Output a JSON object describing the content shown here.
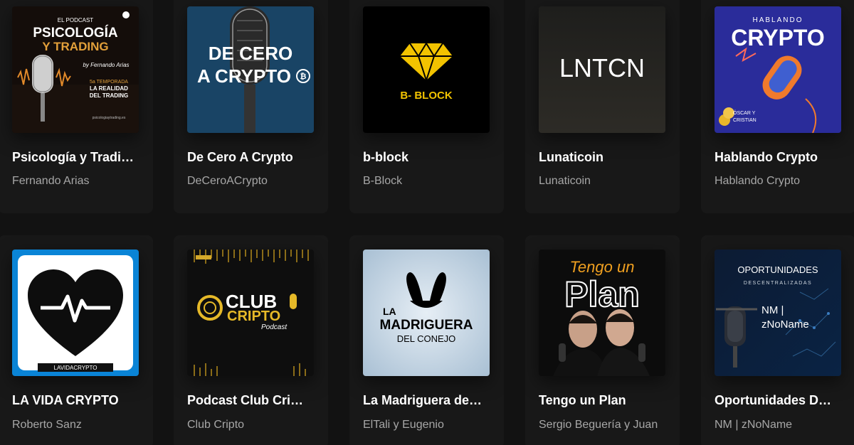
{
  "podcasts": [
    {
      "title": "Psicología y Tradi…",
      "author": "Fernando Arias",
      "cover": {
        "line1": "EL PODCAST",
        "line2": "PSICOLOGÍA",
        "line3": "Y TRADING",
        "line4": "by Fernando Arias",
        "line5": "5a TEMPORADA",
        "line6": "LA REALIDAD",
        "line7": "DEL TRADING",
        "line8": "psicologiaytrading.es"
      }
    },
    {
      "title": "De Cero A Crypto",
      "author": "DeCeroACrypto",
      "cover": {
        "line1": "DE CERO",
        "line2": "A CRYPTO"
      }
    },
    {
      "title": "b-block",
      "author": "B-Block",
      "cover": {
        "line1": "B- BLOCK"
      }
    },
    {
      "title": "Lunaticoin",
      "author": "Lunaticoin",
      "cover": {
        "line1": "LNTCN"
      }
    },
    {
      "title": "Hablando Crypto",
      "author": "Hablando Crypto",
      "cover": {
        "line1": "HABLANDO",
        "line2": "CRYPTO",
        "line3": "ÓSCAR Y",
        "line4": "CRISTIAN"
      }
    },
    {
      "title": "LA VIDA CRYPTO",
      "author": "Roberto Sanz",
      "cover": {
        "line1": "LAVIDACRYPTO"
      }
    },
    {
      "title": "Podcast Club Cri…",
      "author": "Club Cripto",
      "cover": {
        "line1": "CLUB",
        "line2": "CRIPTO",
        "line3": "Podcast"
      }
    },
    {
      "title": "La Madriguera de…",
      "author": "ElTali y Eugenio",
      "cover": {
        "line1": "LA",
        "line2": "MADRIGUERA",
        "line3": "DEL CONEJO"
      }
    },
    {
      "title": "Tengo un Plan",
      "author": "Sergio Beguería y Juan",
      "cover": {
        "line1": "Tengo un",
        "line2": "Plan"
      }
    },
    {
      "title": "Oportunidades D…",
      "author": "NM | zNoName",
      "cover": {
        "line1": "OPORTUNIDADES",
        "line2": "DESCENTRALIZADAS",
        "line3": "NM |",
        "line4": "zNoName"
      }
    }
  ],
  "colors": {
    "background": "#121212",
    "card": "#181818",
    "title": "#ffffff",
    "subtitle": "#a7a7a7"
  }
}
